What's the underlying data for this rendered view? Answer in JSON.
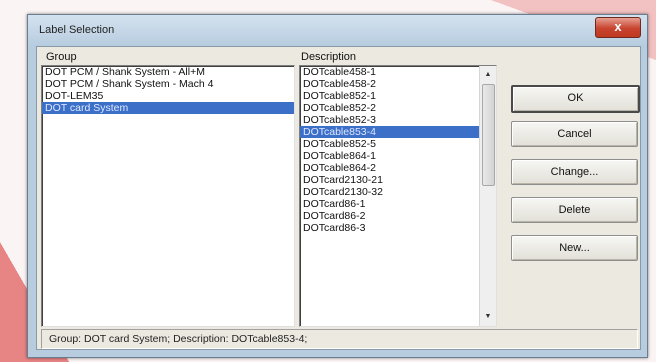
{
  "dialog": {
    "title": "Label Selection",
    "close_symbol": "x"
  },
  "group": {
    "label": "Group",
    "items": [
      "DOT PCM / Shank System - All+M",
      "DOT PCM / Shank System - Mach 4",
      "DOT-LEM35",
      "DOT card System"
    ],
    "selected_index": 3
  },
  "description": {
    "label": "Description",
    "items": [
      "DOTcable458-1",
      "DOTcable458-2",
      "DOTcable852-1",
      "DOTcable852-2",
      "DOTcable852-3",
      "DOTcable853-4",
      "DOTcable852-5",
      "DOTcable864-1",
      "DOTcable864-2",
      "DOTcard2130-21",
      "DOTcard2130-32",
      "DOTcard86-1",
      "DOTcard86-2",
      "DOTcard86-3"
    ],
    "selected_index": 5
  },
  "buttons": {
    "ok": "OK",
    "cancel": "Cancel",
    "change": "Change...",
    "delete": "Delete",
    "new": "New..."
  },
  "status": {
    "text": "Group: DOT card System; Description: DOTcable853-4;"
  },
  "icons": {
    "scroll_up": "scroll-up-arrow-icon",
    "scroll_down": "scroll-down-arrow-icon",
    "close": "close-icon"
  }
}
